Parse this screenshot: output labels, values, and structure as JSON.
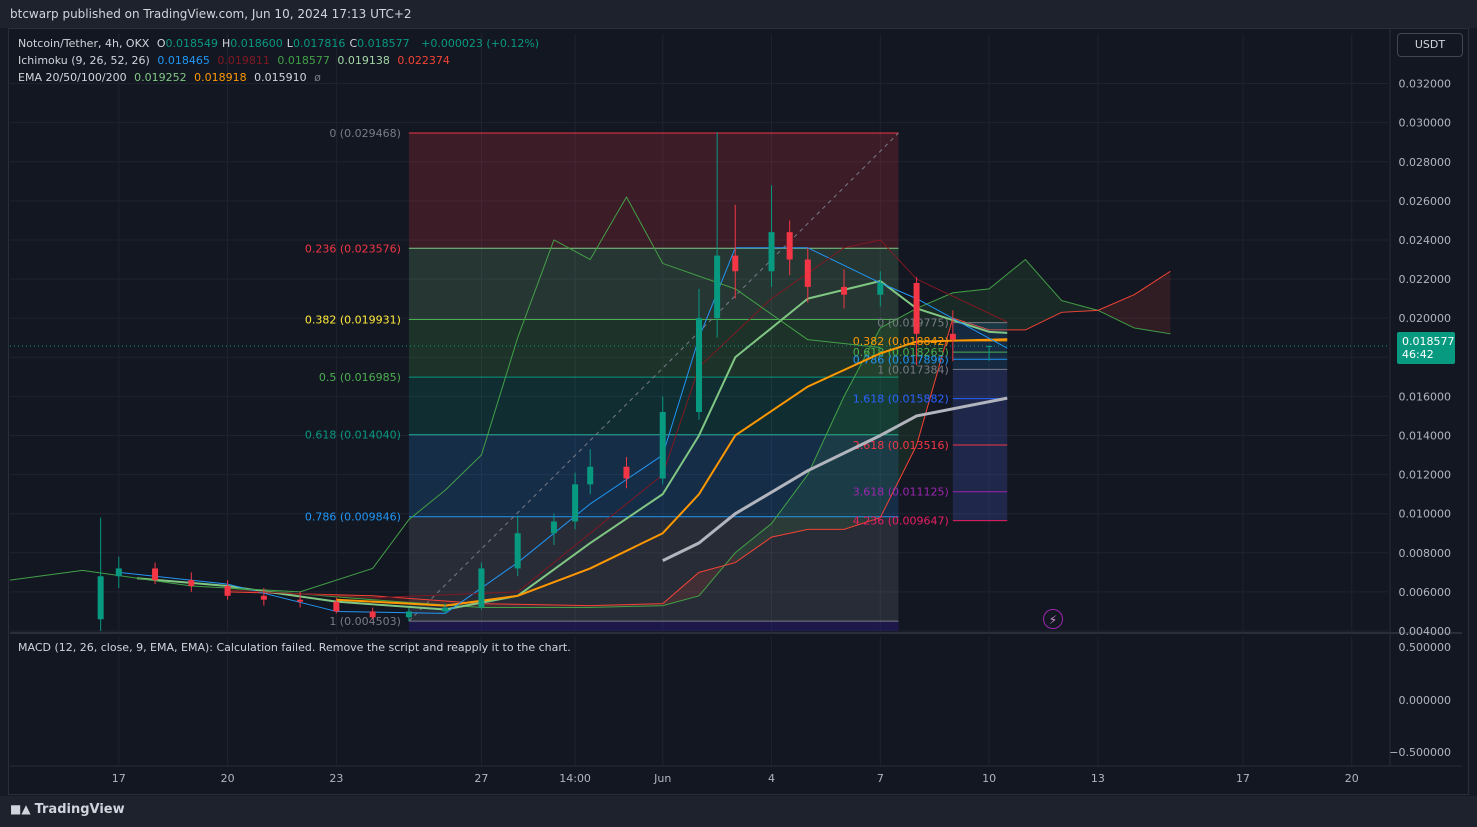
{
  "header": {
    "publisher": "btcwarp published on TradingView.com, Jun 10, 2024 17:13 UTC+2"
  },
  "legend": {
    "symbol": "Notcoin/Tether, 4h, OKX",
    "ohlc": [
      {
        "label": "O",
        "value": "0.018549"
      },
      {
        "label": "H",
        "value": "0.018600"
      },
      {
        "label": "L",
        "value": "0.017816"
      },
      {
        "label": "C",
        "value": "0.018577"
      }
    ],
    "change": "+0.000023 (+0.12%)",
    "ichimoku": {
      "label": "Ichimoku (9, 26, 52, 26)",
      "values": [
        "0.018465",
        "0.019811",
        "0.018577",
        "0.019138",
        "0.022374"
      ]
    },
    "ema": {
      "label": "EMA 20/50/100/200",
      "values": [
        "0.019252",
        "0.018918",
        "0.015910",
        "ø"
      ]
    }
  },
  "currency_button": "USDT",
  "last_price": {
    "value": "0.018577",
    "countdown": "46:42"
  },
  "macd_pane": {
    "label": "MACD (12, 26, close, 9, EMA, EMA): Calculation failed. Remove the script and reapply it to the chart.",
    "ticks": [
      "0.500000",
      "0.000000",
      "−0.500000"
    ]
  },
  "footer": {
    "logo": "TradingView"
  },
  "colors": {
    "bg": "#131722",
    "up": "#089981",
    "down": "#f23645",
    "ema20": "#81c784",
    "ema50": "#ff9800",
    "ema100": "#b2b5be",
    "tenkan": "#2196f3",
    "kijun": "#801922",
    "lagging": "#43a047",
    "cloud_up": "#43a047",
    "cloud_down": "#f44336"
  },
  "chart_data": {
    "type": "candlestick",
    "symbol": "Notcoin/Tether",
    "timeframe": "4h",
    "y_axis": {
      "ylim": [
        0.004,
        0.033
      ],
      "ticks": [
        "0.032000",
        "0.030000",
        "0.028000",
        "0.026000",
        "0.024000",
        "0.022000",
        "0.020000",
        "0.018000",
        "0.016000",
        "0.014000",
        "0.012000",
        "0.010000",
        "0.008000",
        "0.006000",
        "0.004000"
      ]
    },
    "x_axis": {
      "xlim": [
        "2024-05-14",
        "2024-06-21"
      ],
      "ticks": [
        {
          "label": "17",
          "date": "2024-05-17"
        },
        {
          "label": "20",
          "date": "2024-05-20"
        },
        {
          "label": "23",
          "date": "2024-05-23"
        },
        {
          "label": "27",
          "date": "2024-05-27"
        },
        {
          "label": "14:00",
          "date": "2024-05-29T14:00"
        },
        {
          "label": "Jun",
          "date": "2024-06-01"
        },
        {
          "label": "4",
          "date": "2024-06-04"
        },
        {
          "label": "7",
          "date": "2024-06-07"
        },
        {
          "label": "10",
          "date": "2024-06-10"
        },
        {
          "label": "13",
          "date": "2024-06-13"
        },
        {
          "label": "17",
          "date": "2024-06-17"
        },
        {
          "label": "20",
          "date": "2024-06-20"
        }
      ]
    },
    "candles": [
      {
        "t": "2024-05-16T12:00",
        "o": 0.0046,
        "h": 0.0098,
        "l": 0.004,
        "c": 0.0068
      },
      {
        "t": "2024-05-17",
        "o": 0.0068,
        "h": 0.0078,
        "l": 0.0062,
        "c": 0.0072
      },
      {
        "t": "2024-05-18",
        "o": 0.0072,
        "h": 0.0075,
        "l": 0.0064,
        "c": 0.0066
      },
      {
        "t": "2024-05-19",
        "o": 0.0066,
        "h": 0.007,
        "l": 0.006,
        "c": 0.0063
      },
      {
        "t": "2024-05-20",
        "o": 0.0063,
        "h": 0.0066,
        "l": 0.0056,
        "c": 0.0058
      },
      {
        "t": "2024-05-21",
        "o": 0.0058,
        "h": 0.0062,
        "l": 0.0053,
        "c": 0.0056
      },
      {
        "t": "2024-05-22",
        "o": 0.0056,
        "h": 0.006,
        "l": 0.0052,
        "c": 0.0055
      },
      {
        "t": "2024-05-23",
        "o": 0.0055,
        "h": 0.0057,
        "l": 0.0049,
        "c": 0.005
      },
      {
        "t": "2024-05-24",
        "o": 0.005,
        "h": 0.0052,
        "l": 0.0046,
        "c": 0.0047
      },
      {
        "t": "2024-05-25",
        "o": 0.0047,
        "h": 0.0052,
        "l": 0.0045,
        "c": 0.005
      },
      {
        "t": "2024-05-26",
        "o": 0.005,
        "h": 0.0054,
        "l": 0.0049,
        "c": 0.0052
      },
      {
        "t": "2024-05-27",
        "o": 0.0052,
        "h": 0.0075,
        "l": 0.0051,
        "c": 0.0072
      },
      {
        "t": "2024-05-28",
        "o": 0.0072,
        "h": 0.0099,
        "l": 0.0068,
        "c": 0.009
      },
      {
        "t": "2024-05-29",
        "o": 0.009,
        "h": 0.01,
        "l": 0.0084,
        "c": 0.0096
      },
      {
        "t": "2024-05-29T14:00",
        "o": 0.0096,
        "h": 0.0121,
        "l": 0.0092,
        "c": 0.0115
      },
      {
        "t": "2024-05-30",
        "o": 0.0115,
        "h": 0.0133,
        "l": 0.011,
        "c": 0.0124
      },
      {
        "t": "2024-05-31",
        "o": 0.0124,
        "h": 0.0129,
        "l": 0.0113,
        "c": 0.0118
      },
      {
        "t": "2024-06-01",
        "o": 0.0118,
        "h": 0.016,
        "l": 0.0115,
        "c": 0.0152
      },
      {
        "t": "2024-06-02",
        "o": 0.0152,
        "h": 0.0215,
        "l": 0.0148,
        "c": 0.02
      },
      {
        "t": "2024-06-02T12:00",
        "o": 0.02,
        "h": 0.0295,
        "l": 0.019,
        "c": 0.0232
      },
      {
        "t": "2024-06-03",
        "o": 0.0232,
        "h": 0.0258,
        "l": 0.021,
        "c": 0.0224
      },
      {
        "t": "2024-06-04",
        "o": 0.0224,
        "h": 0.0268,
        "l": 0.0216,
        "c": 0.0244
      },
      {
        "t": "2024-06-04T12:00",
        "o": 0.0244,
        "h": 0.025,
        "l": 0.0222,
        "c": 0.023
      },
      {
        "t": "2024-06-05",
        "o": 0.023,
        "h": 0.0236,
        "l": 0.0208,
        "c": 0.0216
      },
      {
        "t": "2024-06-06",
        "o": 0.0216,
        "h": 0.0225,
        "l": 0.0205,
        "c": 0.0212
      },
      {
        "t": "2024-06-07",
        "o": 0.0212,
        "h": 0.0224,
        "l": 0.0206,
        "c": 0.0218
      },
      {
        "t": "2024-06-08",
        "o": 0.0218,
        "h": 0.0221,
        "l": 0.0176,
        "c": 0.0192
      },
      {
        "t": "2024-06-09",
        "o": 0.0192,
        "h": 0.0204,
        "l": 0.0178,
        "c": 0.0189
      },
      {
        "t": "2024-06-10",
        "o": 0.018549,
        "h": 0.0186,
        "l": 0.017816,
        "c": 0.018577
      }
    ],
    "series": [
      {
        "name": "EMA 20",
        "kind": "line",
        "points": [
          [
            "2024-05-17T12:00",
            0.0067
          ],
          [
            "2024-05-20",
            0.0063
          ],
          [
            "2024-05-23",
            0.0055
          ],
          [
            "2024-05-26",
            0.0051
          ],
          [
            "2024-05-28",
            0.0058
          ],
          [
            "2024-05-30",
            0.0085
          ],
          [
            "2024-06-01",
            0.011
          ],
          [
            "2024-06-02",
            0.014
          ],
          [
            "2024-06-03",
            0.018
          ],
          [
            "2024-06-05",
            0.021
          ],
          [
            "2024-06-07",
            0.0219
          ],
          [
            "2024-06-08",
            0.0205
          ],
          [
            "2024-06-10",
            0.0193
          ],
          [
            "2024-06-10T12:00",
            0.01925
          ]
        ]
      },
      {
        "name": "EMA 50",
        "kind": "line",
        "points": [
          [
            "2024-05-23",
            0.0056
          ],
          [
            "2024-05-26",
            0.0053
          ],
          [
            "2024-05-28",
            0.0058
          ],
          [
            "2024-05-30",
            0.0072
          ],
          [
            "2024-06-01",
            0.009
          ],
          [
            "2024-06-02",
            0.011
          ],
          [
            "2024-06-03",
            0.014
          ],
          [
            "2024-06-05",
            0.0165
          ],
          [
            "2024-06-07",
            0.0182
          ],
          [
            "2024-06-08",
            0.0188
          ],
          [
            "2024-06-10T12:00",
            0.01892
          ]
        ]
      },
      {
        "name": "EMA 100",
        "kind": "line",
        "points": [
          [
            "2024-06-01",
            0.0076
          ],
          [
            "2024-06-02",
            0.0085
          ],
          [
            "2024-06-03",
            0.01
          ],
          [
            "2024-06-05",
            0.0122
          ],
          [
            "2024-06-07",
            0.014
          ],
          [
            "2024-06-08",
            0.015
          ],
          [
            "2024-06-10T12:00",
            0.01591
          ]
        ]
      },
      {
        "name": "Tenkan",
        "kind": "line",
        "points": [
          [
            "2024-05-17",
            0.007
          ],
          [
            "2024-05-20",
            0.0064
          ],
          [
            "2024-05-23",
            0.005
          ],
          [
            "2024-05-26",
            0.0049
          ],
          [
            "2024-05-28",
            0.0075
          ],
          [
            "2024-05-30",
            0.0105
          ],
          [
            "2024-06-01",
            0.013
          ],
          [
            "2024-06-02",
            0.019
          ],
          [
            "2024-06-03",
            0.0236
          ],
          [
            "2024-06-05",
            0.0236
          ],
          [
            "2024-06-07",
            0.0218
          ],
          [
            "2024-06-08",
            0.021
          ],
          [
            "2024-06-10T12:00",
            0.018465
          ]
        ]
      },
      {
        "name": "Kijun",
        "kind": "line",
        "points": [
          [
            "2024-05-20",
            0.0061
          ],
          [
            "2024-05-24",
            0.0057
          ],
          [
            "2024-05-28",
            0.006
          ],
          [
            "2024-05-30",
            0.009
          ],
          [
            "2024-06-01",
            0.012
          ],
          [
            "2024-06-02",
            0.0175
          ],
          [
            "2024-06-04",
            0.021
          ],
          [
            "2024-06-06",
            0.0236
          ],
          [
            "2024-06-07",
            0.024
          ],
          [
            "2024-06-08",
            0.022
          ],
          [
            "2024-06-10T12:00",
            0.019811
          ]
        ]
      },
      {
        "name": "Lagging",
        "kind": "line",
        "points": [
          [
            "2024-05-14",
            0.0066
          ],
          [
            "2024-05-16",
            0.0071
          ],
          [
            "2024-05-19",
            0.0063
          ],
          [
            "2024-05-22",
            0.006
          ],
          [
            "2024-05-24",
            0.0072
          ],
          [
            "2024-05-25",
            0.0097
          ],
          [
            "2024-05-26",
            0.0112
          ],
          [
            "2024-05-27",
            0.013
          ],
          [
            "2024-05-28",
            0.019
          ],
          [
            "2024-05-29",
            0.024
          ],
          [
            "2024-05-30",
            0.023
          ],
          [
            "2024-05-31",
            0.0262
          ],
          [
            "2024-06-01",
            0.0228
          ],
          [
            "2024-06-03",
            0.0215
          ],
          [
            "2024-06-05",
            0.0189
          ],
          [
            "2024-06-07",
            0.0185
          ]
        ]
      }
    ],
    "cloud": [
      [
        "2024-05-20",
        0.0062,
        0.006
      ],
      [
        "2024-05-24",
        0.0056,
        0.0058
      ],
      [
        "2024-05-27",
        0.0052,
        0.0054
      ],
      [
        "2024-05-30",
        0.0052,
        0.0053
      ],
      [
        "2024-06-01",
        0.0053,
        0.0054
      ],
      [
        "2024-06-02",
        0.0058,
        0.007
      ],
      [
        "2024-06-03",
        0.008,
        0.0075
      ],
      [
        "2024-06-04",
        0.0095,
        0.0088
      ],
      [
        "2024-06-05",
        0.012,
        0.0092
      ],
      [
        "2024-06-06",
        0.016,
        0.0092
      ],
      [
        "2024-06-07",
        0.0195,
        0.0098
      ],
      [
        "2024-06-08",
        0.0205,
        0.0135
      ],
      [
        "2024-06-09",
        0.0213,
        0.02
      ],
      [
        "2024-06-10",
        0.0215,
        0.0194
      ],
      [
        "2024-06-11",
        0.023,
        0.0194
      ],
      [
        "2024-06-12",
        0.0209,
        0.0203
      ],
      [
        "2024-06-13",
        0.0204,
        0.0204
      ],
      [
        "2024-06-14",
        0.0195,
        0.0212
      ],
      [
        "2024-06-15",
        0.0192,
        0.0224
      ]
    ],
    "fib_retracement": {
      "start": "2024-05-25",
      "end": "2024-06-07T12:00",
      "levels": [
        {
          "label": "0 (0.029468)",
          "price": 0.029468
        },
        {
          "label": "0.236 (0.023576)",
          "price": 0.023576
        },
        {
          "label": "0.382 (0.019931)",
          "price": 0.019931
        },
        {
          "label": "0.5 (0.016985)",
          "price": 0.016985
        },
        {
          "label": "0.618 (0.014040)",
          "price": 0.01404
        },
        {
          "label": "0.786 (0.009846)",
          "price": 0.009846
        },
        {
          "label": "1 (0.004503)",
          "price": 0.004503
        }
      ]
    },
    "fib_extension": {
      "start": "2024-06-09",
      "end": "2024-06-10T12:00",
      "levels": [
        {
          "label": "0 (0.019775)",
          "price": 0.019775
        },
        {
          "label": "0.382 (0.018842)",
          "price": 0.018842
        },
        {
          "label": "0.618 (0.018265)",
          "price": 0.018265
        },
        {
          "label": "0.786 (0.017896)",
          "price": 0.017896
        },
        {
          "label": "1 (0.017384)",
          "price": 0.017384
        },
        {
          "label": "1.618 (0.015882)",
          "price": 0.015882
        },
        {
          "label": "2.618 (0.013516)",
          "price": 0.013516
        },
        {
          "label": "3.618 (0.011125)",
          "price": 0.011125
        },
        {
          "label": "4.236 (0.009647)",
          "price": 0.009647
        }
      ]
    },
    "last_price": 0.018577
  }
}
